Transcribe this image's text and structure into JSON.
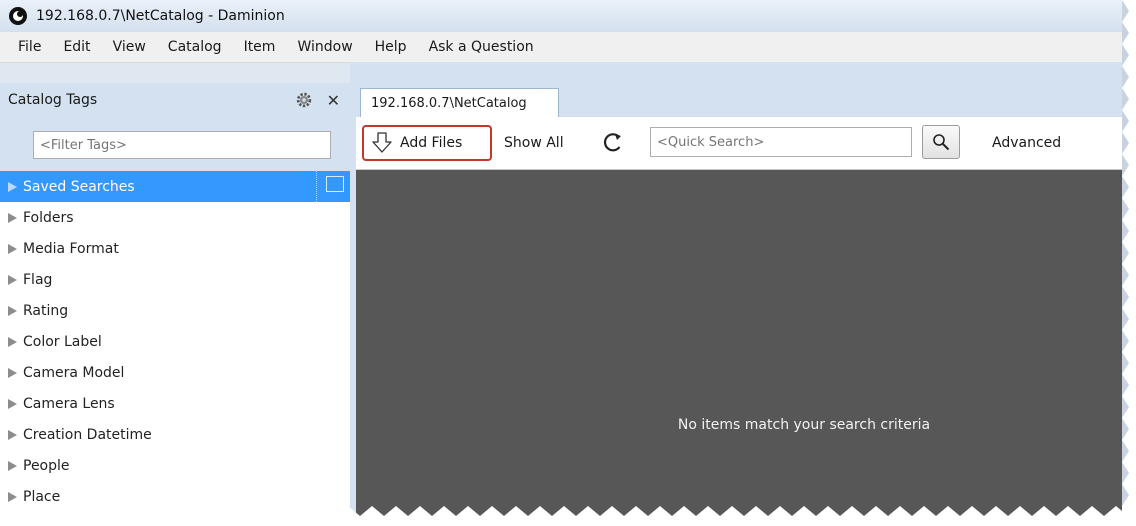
{
  "window": {
    "title": "192.168.0.7\\NetCatalog - Daminion"
  },
  "menu": [
    "File",
    "Edit",
    "View",
    "Catalog",
    "Item",
    "Window",
    "Help",
    "Ask a Question"
  ],
  "left_panel": {
    "title": "Catalog Tags",
    "filter_placeholder": "<Filter Tags>",
    "tags": [
      "Saved Searches",
      "Folders",
      "Media Format",
      "Flag",
      "Rating",
      "Color Label",
      "Camera Model",
      "Camera Lens",
      "Creation Datetime",
      "People",
      "Place"
    ],
    "selected_tag": "Saved Searches"
  },
  "tab": {
    "label": "192.168.0.7\\NetCatalog"
  },
  "toolbar": {
    "add_files_label": "Add Files",
    "show_all_label": "Show All",
    "quick_search_placeholder": "<Quick Search>",
    "advanced_label": "Advanced"
  },
  "content": {
    "empty_message": "No items match your search criteria"
  },
  "colors": {
    "selection": "#3399ff",
    "content_bg": "#575757",
    "highlight_border": "#c0392b",
    "panel_bg": "#d4e1f0"
  },
  "icons": [
    "app-logo-icon",
    "gear-icon",
    "close-icon",
    "expand-arrow-icon",
    "add-files-arrow-icon",
    "refresh-icon",
    "search-icon"
  ]
}
